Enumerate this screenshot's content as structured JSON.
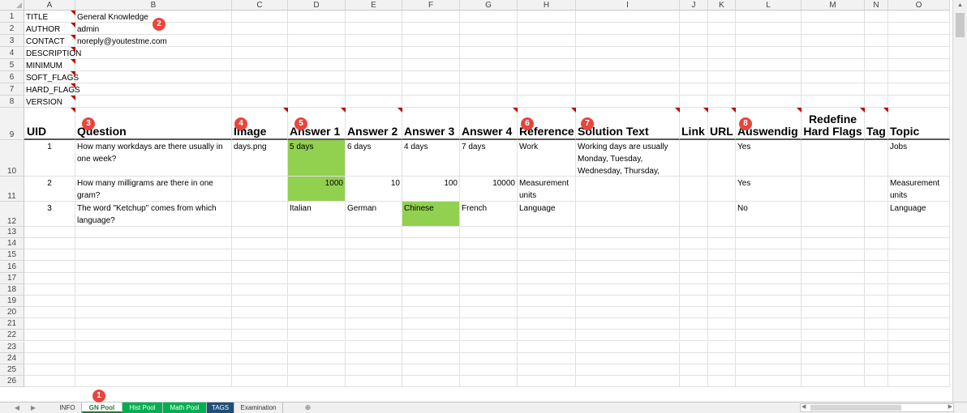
{
  "columns": [
    "A",
    "B",
    "C",
    "D",
    "E",
    "F",
    "G",
    "H",
    "I",
    "J",
    "K",
    "L",
    "M",
    "N",
    "O"
  ],
  "meta": [
    {
      "key": "TITLE",
      "value": "General Knowledge"
    },
    {
      "key": "AUTHOR",
      "value": "admin"
    },
    {
      "key": "CONTACT",
      "value": "noreply@youtestme.com"
    },
    {
      "key": "DESCRIPTION",
      "value": ""
    },
    {
      "key": "MINIMUM",
      "value": ""
    },
    {
      "key": "SOFT_FLAGS",
      "value": ""
    },
    {
      "key": "HARD_FLAGS",
      "value": ""
    },
    {
      "key": "VERSION",
      "value": ""
    }
  ],
  "headers": [
    "UID",
    "Question",
    "Image",
    "Answer 1",
    "Answer 2",
    "Answer 3",
    "Answer 4",
    "Reference",
    "Solution Text",
    "Link",
    "URL",
    "Auswendig",
    "Redefine Hard Flags",
    "Tag",
    "Topic"
  ],
  "rows": [
    {
      "uid": "1",
      "question": "How many workdays are there usually in one week?",
      "image": "days.png",
      "a1": "5 days",
      "a2": "6 days",
      "a3": "4 days",
      "a4": "7 days",
      "reference": "Work",
      "solution": "Working days are usually Monday, Tuesday, Wednesday, Thursday,",
      "link": "",
      "url": "",
      "auswendig": "Yes",
      "redefine": "",
      "tag": "",
      "topic": "Jobs",
      "correct": "a1",
      "numeric": false
    },
    {
      "uid": "2",
      "question": "How many milligrams are there in one gram?",
      "image": "",
      "a1": "1000",
      "a2": "10",
      "a3": "100",
      "a4": "10000",
      "reference": "Measurement units",
      "solution": "",
      "link": "",
      "url": "",
      "auswendig": "Yes",
      "redefine": "",
      "tag": "",
      "topic": "Measurement units",
      "correct": "a1",
      "numeric": true
    },
    {
      "uid": "3",
      "question": "The word \"Ketchup\" comes from which language?",
      "image": "",
      "a1": "Italian",
      "a2": "German",
      "a3": "Chinese",
      "a4": "French",
      "reference": "Language",
      "solution": "",
      "link": "",
      "url": "",
      "auswendig": "No",
      "redefine": "",
      "tag": "",
      "topic": "Language",
      "correct": "a3",
      "numeric": false
    }
  ],
  "badges": [
    "1",
    "2",
    "3",
    "4",
    "5",
    "6",
    "7",
    "8"
  ],
  "sheet_tabs": [
    {
      "label": "INFO",
      "bg": "#f0f0f0",
      "fg": "#333333",
      "active": false
    },
    {
      "label": "GN Pool",
      "bg": "#ffffff",
      "fg": "#1e7b36",
      "active": true
    },
    {
      "label": "Hist Pool",
      "bg": "#00b050",
      "fg": "#ffffff",
      "active": false
    },
    {
      "label": "Math Pool",
      "bg": "#00b050",
      "fg": "#ffffff",
      "active": false
    },
    {
      "label": "TAGS",
      "bg": "#1f4e79",
      "fg": "#ffffff",
      "active": false
    },
    {
      "label": "Examination",
      "bg": "#f0f0f0",
      "fg": "#333333",
      "active": false
    }
  ],
  "colors": {
    "correct_answer": "#92d050",
    "badge": "#e8453c",
    "comment_marker": "#c00000"
  },
  "icons": [
    "select-all-corner-icon",
    "add-sheet-icon",
    "scroll-left-icon",
    "scroll-right-icon",
    "scroll-up-icon"
  ]
}
